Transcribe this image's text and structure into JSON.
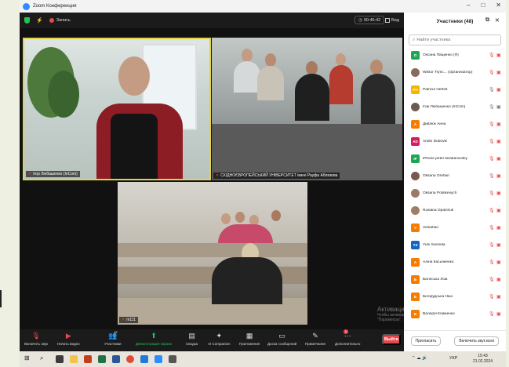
{
  "window": {
    "title": "Zoom Конференция"
  },
  "topbar": {
    "record_label": "Запись",
    "timer": "00:46:42",
    "view_label": "Вид"
  },
  "tiles": [
    {
      "name": "Ігор Любашенко (InCom)",
      "muted": true
    },
    {
      "name": "СХІДНОЄВРОПЕЙСЬКИЙ УНІВЕРСИТЕТ імені Рауфа Аблязова",
      "muted": true
    },
    {
      "name": "m111",
      "muted": true
    }
  ],
  "sidebar": {
    "title": "Участники (48)",
    "search_placeholder": "Найти участника",
    "participants": [
      {
        "initials": "O",
        "name": "Оксана Пащенко (Я)",
        "color": "#23a455",
        "muted": true,
        "cam_off": true,
        "photo": false
      },
      {
        "initials": "",
        "name": "Wiktor Trync... (Организатор)",
        "color": "#8a6a5a",
        "muted": true,
        "cam_off": true,
        "photo": true
      },
      {
        "initials": "PH",
        "name": "Patricia Herbst",
        "color": "#f4b400",
        "muted": false,
        "cam_off": true,
        "photo": false
      },
      {
        "initials": "",
        "name": "Ігор Любашенко (InCom)",
        "color": "#6b5a50",
        "muted": false,
        "cam_off": false,
        "photo": true
      },
      {
        "initials": "A",
        "name": "Дивлюк Анна",
        "color": "#f57c00",
        "muted": true,
        "cam_off": true,
        "photo": false
      },
      {
        "initials": "AD",
        "name": "Andrii Dubovik",
        "color": "#d81b60",
        "muted": true,
        "cam_off": true,
        "photo": false
      },
      {
        "initials": "IP",
        "name": "iPhone peter tarabanovsky",
        "color": "#23a455",
        "muted": true,
        "cam_off": true,
        "photo": false
      },
      {
        "initials": "",
        "name": "Oksana Orehan",
        "color": "#7a5b4b",
        "muted": true,
        "cam_off": true,
        "photo": true
      },
      {
        "initials": "",
        "name": "Oksana Polinkevych",
        "color": "#9c7a66",
        "muted": true,
        "cam_off": true,
        "photo": true
      },
      {
        "initials": "",
        "name": "Ruslana Opalchuk",
        "color": "#a07d68",
        "muted": true,
        "cam_off": true,
        "photo": true
      },
      {
        "initials": "V",
        "name": "Volodhan",
        "color": "#f57c00",
        "muted": true,
        "cam_off": true,
        "photo": false
      },
      {
        "initials": "YS",
        "name": "Yurii Svereda",
        "color": "#1565c0",
        "muted": true,
        "cam_off": true,
        "photo": false
      },
      {
        "initials": "A",
        "name": "Аліна Касьяненко",
        "color": "#f57c00",
        "muted": true,
        "cam_off": true,
        "photo": false
      },
      {
        "initials": "Б",
        "name": "Багінська Ліза",
        "color": "#f57c00",
        "muted": true,
        "cam_off": true,
        "photo": false
      },
      {
        "initials": "Б",
        "name": "Білорудська Ніка",
        "color": "#f57c00",
        "muted": true,
        "cam_off": true,
        "photo": false
      },
      {
        "initials": "В",
        "name": "Валерія Клименко",
        "color": "#f57c00",
        "muted": true,
        "cam_off": true,
        "photo": false
      }
    ],
    "invite_label": "Пригласить",
    "unmute_all_label": "Включить звук всех"
  },
  "toolbar": {
    "unmute": "Включить звук",
    "start_video": "Начать видео",
    "participants": "Участники",
    "participants_count": "48",
    "share": "Демонстрация экрана",
    "summary": "Сводка",
    "ai_companion": "AI Companion",
    "reactions": "Приложения",
    "chat": "Доска сообщений",
    "notes": "Примечания",
    "more": "Дополнительно",
    "more_badge": "1",
    "leave": "Выйти"
  },
  "watermark": {
    "title": "Активация Windows",
    "subtitle": "Чтобы активировать Windows, перейдите в раздел \"Параметры\"."
  },
  "taskbar": {
    "lang": "УКР",
    "time": "15:43",
    "date": "21.02.2024"
  },
  "colors": {
    "accent": "#2d8cff",
    "danger": "#e5484d",
    "active": "#23c552",
    "speaker": "#e0d34a"
  }
}
